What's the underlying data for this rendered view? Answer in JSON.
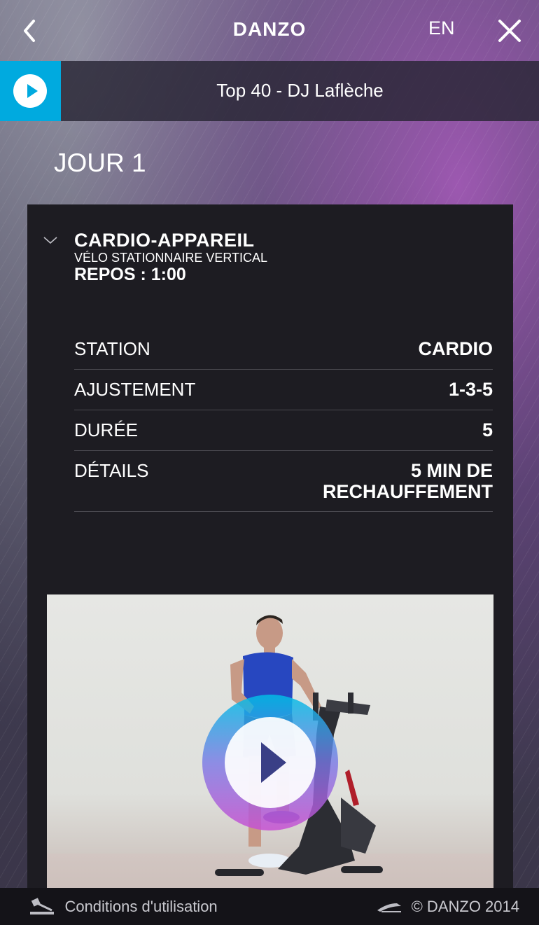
{
  "header": {
    "brand": "DANZO",
    "language": "EN",
    "back_icon": "chevron-left-icon",
    "close_icon": "close-icon"
  },
  "player": {
    "track_title": "Top 40 - DJ Laflèche",
    "play_icon": "play-icon",
    "accent_color": "#00aadf"
  },
  "day": {
    "title": "JOUR 1"
  },
  "exercise": {
    "title": "CARDIO-APPAREIL",
    "subtitle": "VÉLO STATIONNAIRE VERTICAL",
    "rest": "REPOS : 1:00",
    "toggle_icon": "chevron-down-icon",
    "details": [
      {
        "label": "STATION",
        "value": "CARDIO"
      },
      {
        "label": "AJUSTEMENT",
        "value": "1-3-5"
      },
      {
        "label": "DURÉE",
        "value": "5"
      },
      {
        "label": "DÉTAILS",
        "value": "5 MIN DE RECHAUFFEMENT"
      }
    ],
    "video_play_icon": "play-icon"
  },
  "footer": {
    "terms": "Conditions d'utilisation",
    "terms_icon": "gavel-icon",
    "copyright": "© DANZO 2014",
    "copyright_icon": "danzo-logo-icon"
  }
}
